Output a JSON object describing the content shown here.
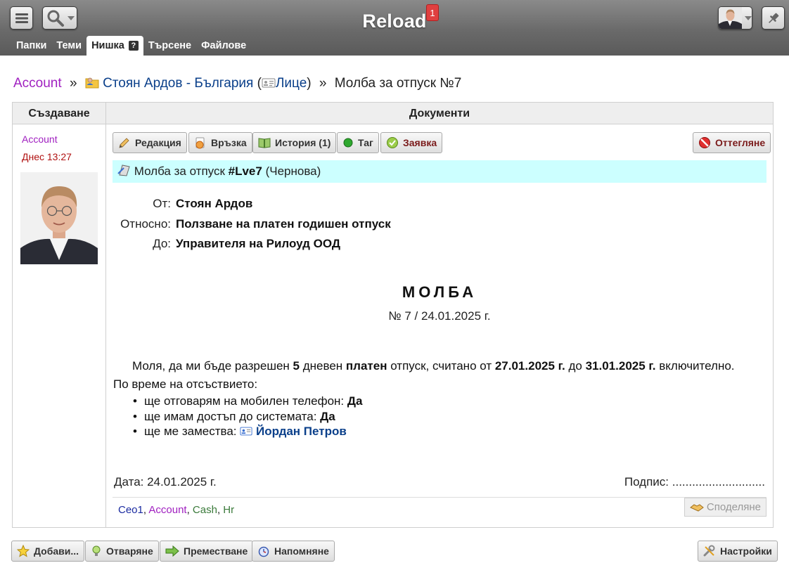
{
  "topbar": {
    "app_title": "Reload",
    "notification_count": "1"
  },
  "tabs": [
    {
      "label": "Папки"
    },
    {
      "label": "Теми"
    },
    {
      "label": "Нишка",
      "active": true,
      "help": "?"
    },
    {
      "label": "Търсене"
    },
    {
      "label": "Файлове"
    }
  ],
  "breadcrumb": {
    "root": "Account",
    "sep1": "»",
    "folder": "Стоян Ардов - България",
    "open_paren": "(",
    "folder_type": "Лице",
    "close_paren": ")",
    "sep2": "»",
    "current": "Молба за отпуск №7"
  },
  "table": {
    "col_left": "Създаване",
    "col_right": "Документи"
  },
  "creator": {
    "name": "Account",
    "time": "Днес 13:27"
  },
  "toolbar": {
    "edit": "Редакция",
    "link": "Връзка",
    "history": "История (1)",
    "tag": "Таг",
    "request": "Заявка",
    "reject": "Оттегляне"
  },
  "document": {
    "header_prefix": "Молба за отпуск",
    "header_code": "#Lve7",
    "header_status": "(Чернова)",
    "meta": [
      {
        "label": "От:",
        "value": "Стоян Ардов"
      },
      {
        "label": "Относно:",
        "value": "Ползване на платен годишен отпуск"
      },
      {
        "label": "До:",
        "value": "Управителя на Рилоуд ООД"
      }
    ],
    "title": "МОЛБА",
    "number_line": "№ 7 / 24.01.2025 г.",
    "body": {
      "p1_a": "Моля, да ми бъде разрешен ",
      "days": "5",
      "p1_b": " дневен ",
      "paid": "платен",
      "p1_c": " отпуск, считано от ",
      "from": "27.01.2025 г.",
      "p1_d": " до ",
      "to": "31.01.2025 г.",
      "p1_e": " включително.",
      "p2": "По време на отсъствието:",
      "item1_text": "ще отговарям на мобилен телефон: ",
      "item1_val": "Да",
      "item2_text": "ще имам достъп до системата: ",
      "item2_val": "Да",
      "item3_text": "ще ме замества: ",
      "item3_val": "Йордан Петров"
    },
    "date_line": "Дата: 24.01.2025 г.",
    "sign_line": "Подпис: ............................"
  },
  "tags": {
    "t1": "Ceo1",
    "t2": "Account",
    "t3": "Cash",
    "t4": "Hr",
    "comma": ","
  },
  "share_label": "Споделяне",
  "bottom": {
    "add": "Добави...",
    "open": "Отваряне",
    "move": "Преместване",
    "remind": "Напомняне",
    "settings": "Настройки"
  }
}
